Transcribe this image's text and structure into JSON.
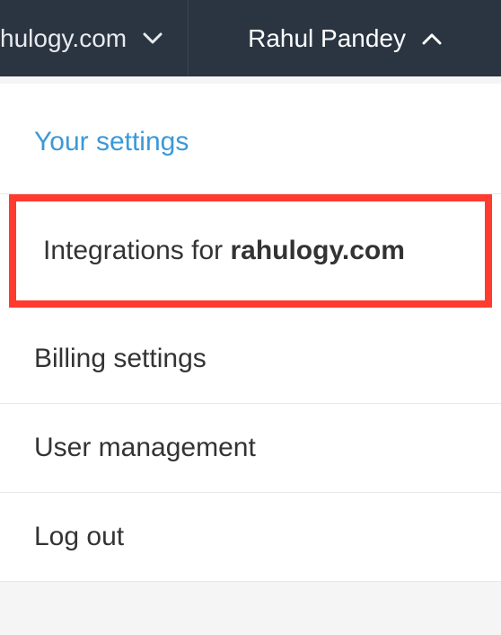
{
  "topbar": {
    "domain_partial": "hulogy.com",
    "user_name": "Rahul Pandey"
  },
  "menu": {
    "your_settings": "Your settings",
    "integrations_prefix": "Integrations for ",
    "integrations_domain": "rahulogy.com",
    "billing": "Billing settings",
    "user_mgmt": "User management",
    "logout": "Log out"
  },
  "colors": {
    "accent": "#3b99d8",
    "highlight_border": "#ff3b2f",
    "topbar_bg": "#2b3542"
  }
}
